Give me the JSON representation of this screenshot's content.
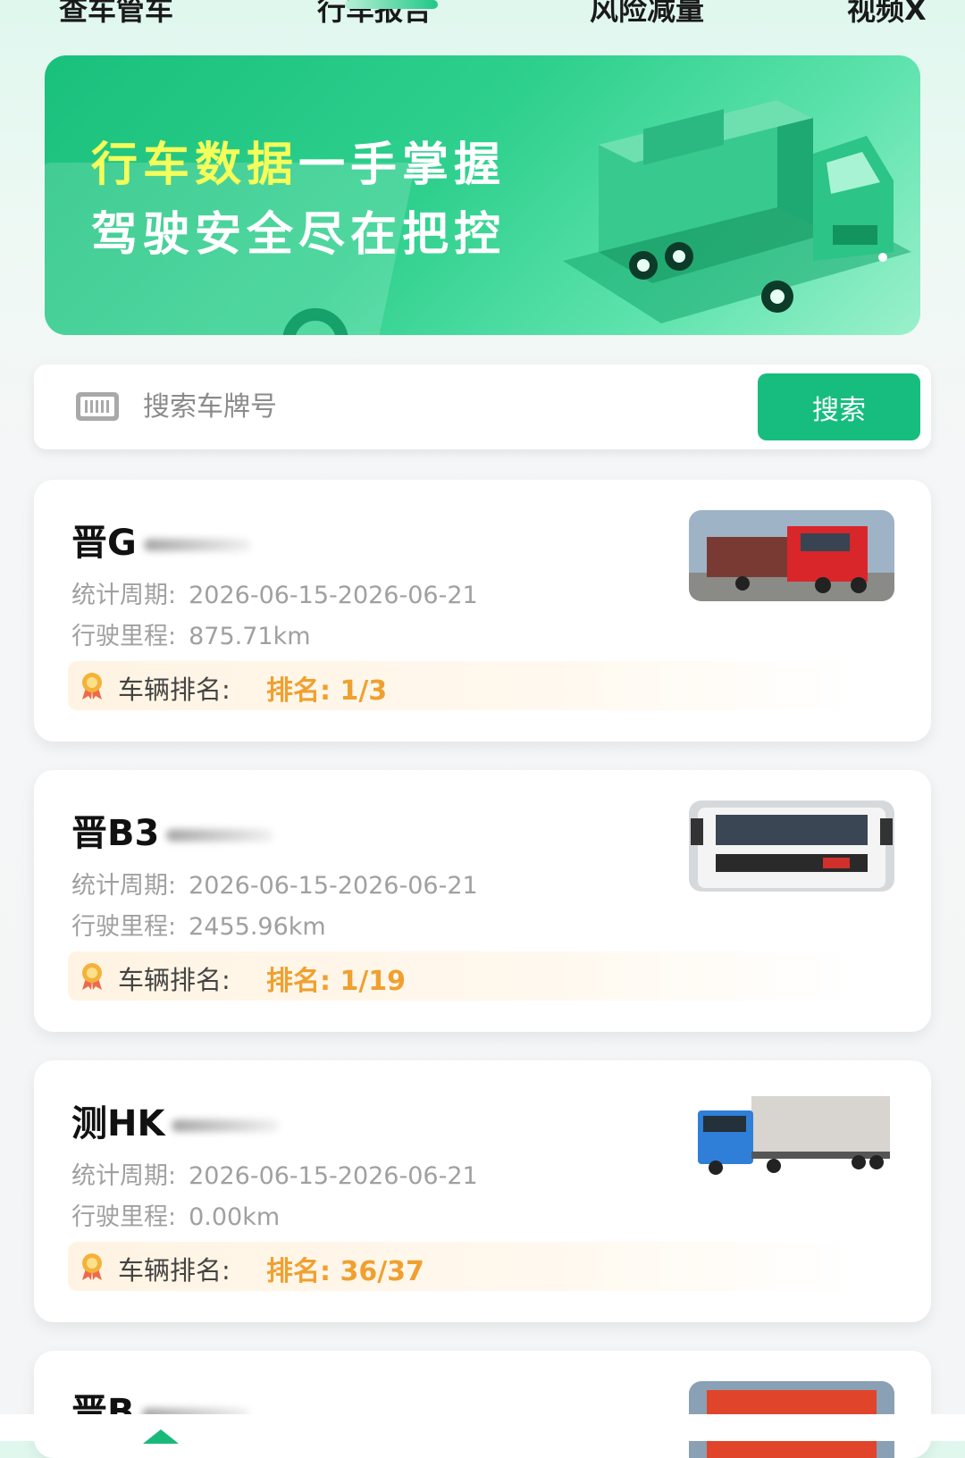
{
  "tabs": {
    "items": [
      {
        "label": "查车管车"
      },
      {
        "label": "行车报告"
      },
      {
        "label": "风险减量"
      },
      {
        "label": "视频X"
      }
    ]
  },
  "banner": {
    "line1_highlight": "行车数据",
    "line1_rest": "一手掌握",
    "line2": "驾驶安全尽在把控"
  },
  "search": {
    "placeholder": "搜索车牌号",
    "button_label": "搜索"
  },
  "vehicles": [
    {
      "plate": "晋G",
      "period_label": "统计周期:",
      "period_value": "2026-06-15-2026-06-21",
      "mileage_label": "行驶里程:",
      "mileage_value": "875.71km",
      "rank_label": "车辆排名:",
      "rank_value": "排名: 1/3",
      "photo_color": "#d9262b"
    },
    {
      "plate": "晋B3",
      "period_label": "统计周期:",
      "period_value": "2026-06-15-2026-06-21",
      "mileage_label": "行驶里程:",
      "mileage_value": "2455.96km",
      "rank_label": "车辆排名:",
      "rank_value": "排名: 1/19",
      "photo_color": "#f2f2f2"
    },
    {
      "plate": "测HK",
      "period_label": "统计周期:",
      "period_value": "2026-06-15-2026-06-21",
      "mileage_label": "行驶里程:",
      "mileage_value": "0.00km",
      "rank_label": "车辆排名:",
      "rank_value": "排名: 36/37",
      "photo_color": "#2f7fd8"
    },
    {
      "plate": "晋B"
    }
  ],
  "colors": {
    "accent": "#17bd7f",
    "rank_orange": "#f0a030",
    "muted_text": "#a0a0a0"
  }
}
